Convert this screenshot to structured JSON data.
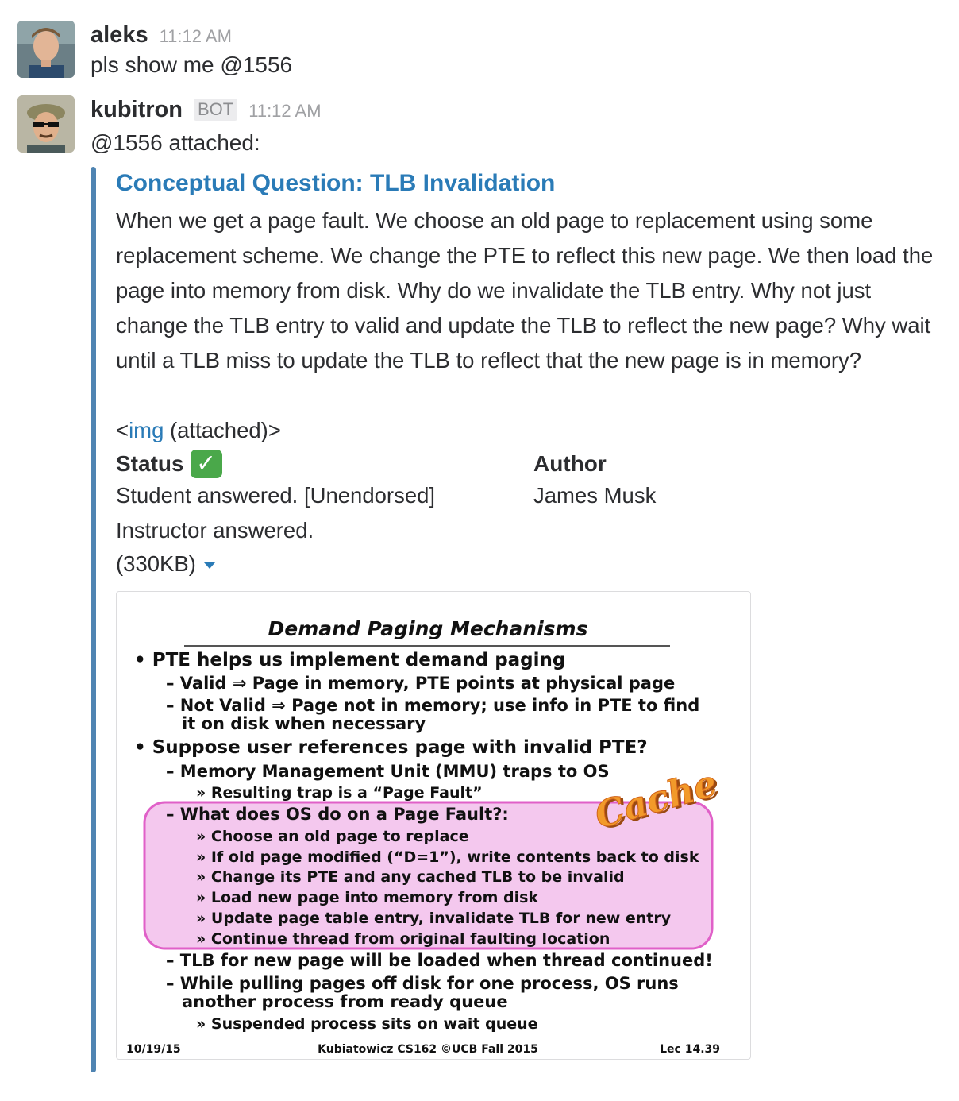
{
  "messages": [
    {
      "username": "aleks",
      "time": "11:12 AM",
      "text": "pls show me @1556"
    },
    {
      "username": "kubitron",
      "bot_tag": "BOT",
      "time": "11:12 AM",
      "text": "@1556 attached:"
    }
  ],
  "attachment": {
    "accent_color": "#4f84b2",
    "title": "Conceptual Question: TLB Invalidation",
    "body": "When we get a page fault. We choose an old page to replacement using some replacement scheme. We change the PTE to reflect this new page. We then load the page into memory from disk. Why do we invalidate the TLB entry. Why not just change the TLB entry to valid and update the TLB to reflect the new page? Why wait until a TLB miss to update the TLB to reflect that the new page is in memory?",
    "img_prefix": "<",
    "img_link": "img",
    "img_suffix": " (attached)>",
    "fields": {
      "status": {
        "title": "Status",
        "icon": "check-mark-emoji",
        "lines": [
          "Student answered. [Unendorsed]",
          "Instructor answered."
        ]
      },
      "author": {
        "title": "Author",
        "value": "James Musk"
      }
    },
    "file_size": "(330KB)"
  },
  "slide": {
    "title": "Demand Paging Mechanisms",
    "lines": [
      "• PTE helps us implement demand paging",
      "– Valid ⇒ Page in memory, PTE points at physical page",
      "– Not Valid ⇒ Page not in memory; use info in PTE to find",
      "it on disk when necessary",
      "• Suppose user references page with invalid PTE?",
      "– Memory Management Unit (MMU) traps to OS",
      "» Resulting trap is a “Page Fault”",
      "– What does OS do on a Page Fault?:",
      "» Choose an old page to replace",
      "» If old page modified (“D=1”), write contents back to disk",
      "» Change its PTE and any cached TLB to be invalid",
      "» Load new page into memory from disk",
      "» Update page table entry, invalidate TLB for new entry",
      "» Continue thread from original faulting location",
      "– TLB for new page will be loaded when thread continued!",
      "– While pulling pages off disk for one process, OS runs",
      "another process from ready queue",
      "» Suspended process sits on wait queue"
    ],
    "cache_stamp": "Cache",
    "footer_left": "10/19/15",
    "footer_center": "Kubiatowicz CS162 ©UCB Fall 2015",
    "footer_right": "Lec 14.39",
    "colors": {
      "title": "#2233dd",
      "highlight_fill": "#f4c8ee",
      "highlight_stroke": "#e060c8",
      "footer": "#2233aa",
      "stamp": "#e8781a"
    }
  }
}
